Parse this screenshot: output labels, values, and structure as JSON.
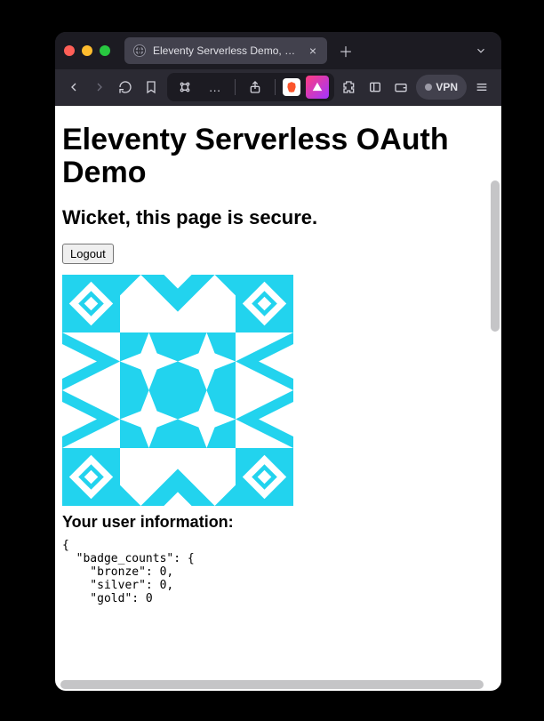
{
  "browser": {
    "tab_title": "Eleventy Serverless Demo, OA",
    "vpn_label": "VPN"
  },
  "page": {
    "heading": "Eleventy Serverless OAuth Demo",
    "subheading": "Wicket, this page is secure.",
    "logout_label": "Logout",
    "user_info_heading": "Your user information:",
    "user_info_json": "{\n  \"badge_counts\": {\n    \"bronze\": 0,\n    \"silver\": 0,\n    \"gold\": 0"
  },
  "colors": {
    "identicon": "#22d3ee"
  }
}
